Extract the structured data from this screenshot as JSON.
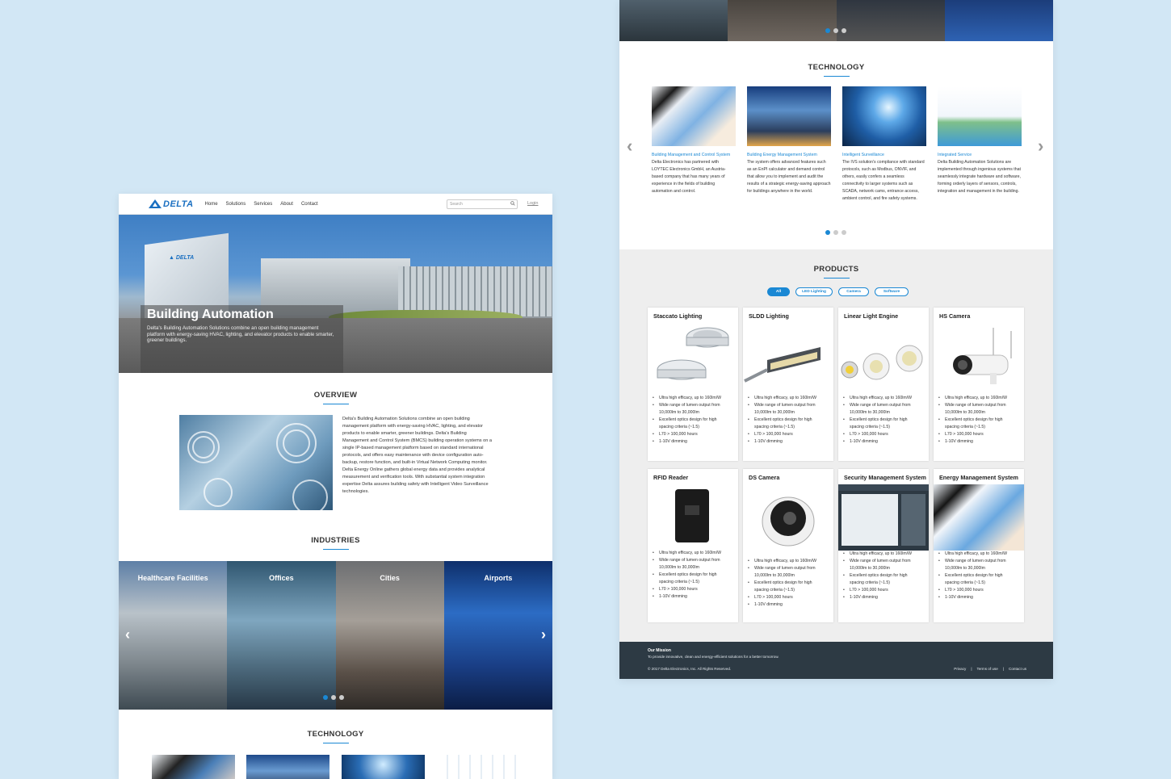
{
  "left": {
    "logo": "DELTA",
    "nav": [
      "Home",
      "Solutions",
      "Services",
      "About",
      "Contact"
    ],
    "search_placeholder": "Search",
    "login": "Login",
    "hero": {
      "title": "Building Automation",
      "desc": "Delta's Building Automation Solutions combine an open building management platform with energy-saving HVAC, lighting, and elevator products to enable smarter, greener buildings."
    },
    "overview": {
      "title": "OVERVIEW",
      "text": "Delta's Building Automation Solutions combine an open building management platform with energy-saving HVAC, lighting, and elevator products to enable smarter, greener buildings. Delta's Building Management and Control System (BMCS) building operation systems on a single IP-based management platform based on standard international protocols, and offers easy maintenance with device configuration auto-backup, restore function, and built-in Virtual Network Computing monitor. Delta Energy Online gathers global energy data and provides analytical measurement and verification tools. With substantial system integration expertise Delta assures building safety with Intelligent Video Surveillance technologies."
    },
    "industries": {
      "title": "INDUSTRIES",
      "items": [
        "Healthcare Facilities",
        "Offices",
        "Cities",
        "Airports"
      ]
    },
    "technology_title": "TECHNOLOGY"
  },
  "right": {
    "technology": {
      "title": "TECHNOLOGY",
      "items": [
        {
          "title": "Building Management and Control System",
          "desc": "Delta Electronics has partnered with LOYTEC Electronics GmbH, an Austria-based company that has many years of experience in the fields of building automation and control."
        },
        {
          "title": "Building Energy Management System",
          "desc": "The system offers advanced features such as an EnPI calculator and demand control that allow you to implement and audit the results of a strategic energy-saving approach for buildings anywhere in the world."
        },
        {
          "title": "Intelligent Surveillance",
          "desc": "The IVS solution's compliance with standard protocols, such as Modbus, ONVIF, and others, easily confers a seamless connectivity to larger systems such as SCADA, network cams, entrance access, ambient control, and fire safety systems."
        },
        {
          "title": "Integrated Service",
          "desc": "Delta Building Automation Solutions are implemented through ingenious systems that seamlessly integrate hardware and software, forming orderly layers of sensors, controls, integration and management in the building."
        }
      ]
    },
    "products": {
      "title": "PRODUCTS",
      "filters": [
        "All",
        "LED Lighting",
        "Camera",
        "Software"
      ],
      "items": [
        {
          "name": "Staccato Lighting"
        },
        {
          "name": "SLDD Lighting"
        },
        {
          "name": "Linear Light Engine"
        },
        {
          "name": "HS Camera"
        },
        {
          "name": "RFID Reader"
        },
        {
          "name": "DS Camera"
        },
        {
          "name": "Security Management System"
        },
        {
          "name": "Energy Management System"
        }
      ],
      "specs": [
        "Ultra high efficacy, up to 160lm/W",
        "Wide range of lumen output from",
        "10,000lm to 30,000lm",
        "Excellent optics design for high",
        "spacing criteria (~1.5)",
        "L70 > 100,000 hours",
        "1-10V dimming"
      ]
    },
    "footer": {
      "mission_title": "Our Mission",
      "mission_text": "To provide innovative, clean and energy-efficient solutions for a better tomorrow.",
      "copyright": "© 2017 Delta Electronics, Inc. All Rights Reserved.",
      "links": [
        "Privacy",
        "|",
        "Terms of use",
        "|",
        "Contact us"
      ]
    }
  },
  "colors": {
    "accent": "#1a88d4",
    "footer": "#2d3a44",
    "background": "#d2e7f5"
  }
}
